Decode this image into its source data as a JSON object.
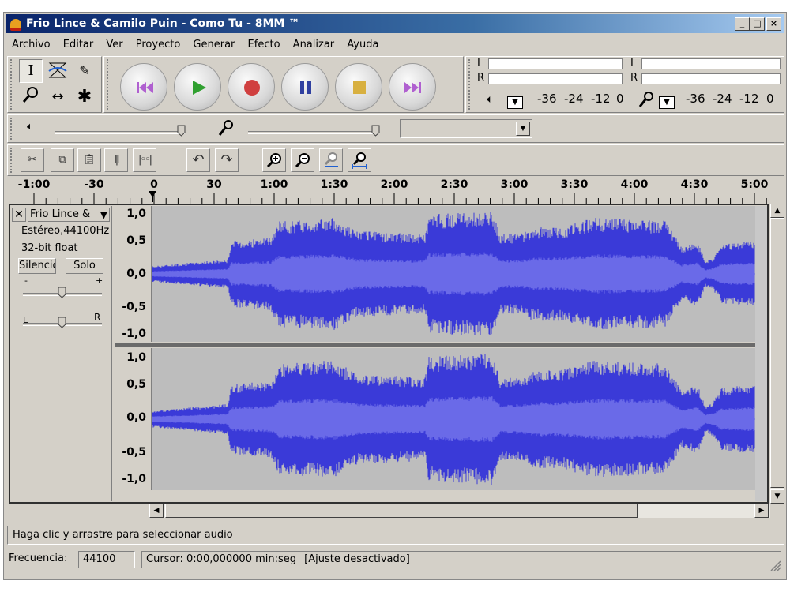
{
  "window": {
    "title": "Frio Lince & Camilo Puin - Como Tu - 8MM ™",
    "minimize": "_",
    "maximize": "□",
    "close": "×"
  },
  "menu": [
    "Archivo",
    "Editar",
    "Ver",
    "Proyecto",
    "Generar",
    "Efecto",
    "Analizar",
    "Ayuda"
  ],
  "meters": {
    "left_label": "I",
    "right_label": "R",
    "playback_scale": [
      "-36",
      "-24",
      "-12",
      "0"
    ],
    "record_scale": [
      "-36",
      "-24",
      "-12",
      "0"
    ]
  },
  "mixer": {
    "input_select": ""
  },
  "timeline": {
    "ticks": [
      "-1:00",
      "-30",
      "0",
      "30",
      "1:00",
      "1:30",
      "2:00",
      "2:30",
      "3:00",
      "3:30",
      "4:00",
      "4:30",
      "5:00"
    ]
  },
  "track": {
    "name": "Frio Lince &",
    "format": "Estéreo,44100Hz",
    "bitdepth": "32-bit float",
    "mute": "Silencio",
    "solo": "Solo",
    "gain_minus": "-",
    "gain_plus": "+",
    "pan_left": "L",
    "pan_right": "R",
    "scale": [
      "1,0",
      "0,5",
      "0,0",
      "-0,5",
      "-1,0"
    ]
  },
  "status": {
    "hint": "Haga clic y arrastre para seleccionar audio",
    "rate_label": "Frecuencia:",
    "rate_value": "44100",
    "cursor": "Cursor: 0:00,000000 min:seg",
    "snap": "[Ajuste desactivado]"
  },
  "colors": {
    "wave": "#3a3ad8",
    "wave_rms": "#6a6ae8",
    "wave_bg": "#bdbdbd",
    "rewind": "#b060d0",
    "play": "#30a030",
    "record": "#d04040",
    "pause": "#3040a0",
    "stop": "#d8b040",
    "ffwd": "#b060d0"
  }
}
